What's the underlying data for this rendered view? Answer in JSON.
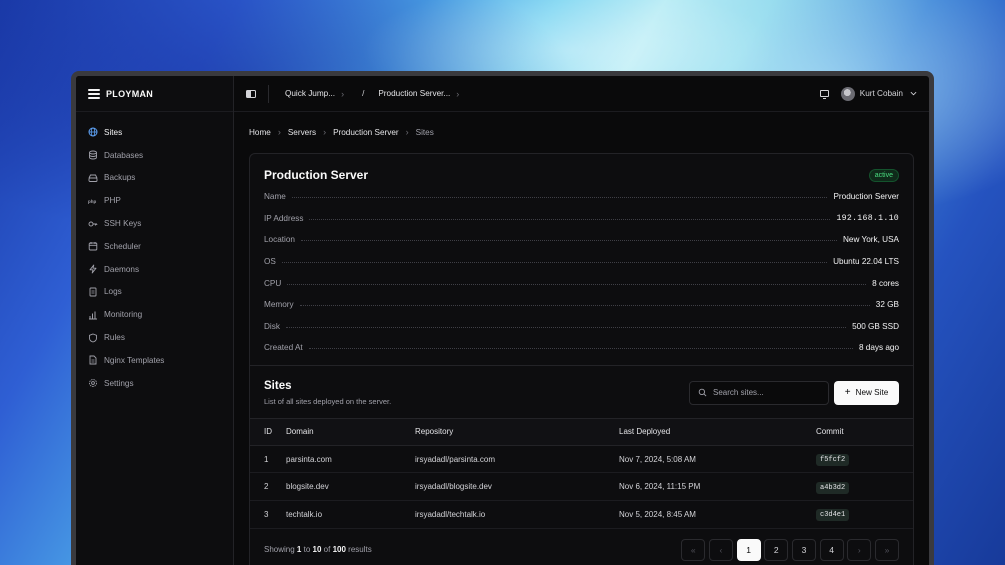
{
  "brand": {
    "name": "PLOYMAN"
  },
  "sidebar": {
    "items": [
      {
        "label": "Sites",
        "icon": "globe-icon",
        "active": true
      },
      {
        "label": "Databases",
        "icon": "database-icon"
      },
      {
        "label": "Backups",
        "icon": "hard-drive-icon"
      },
      {
        "label": "PHP",
        "icon": "php-icon"
      },
      {
        "label": "SSH Keys",
        "icon": "key-icon"
      },
      {
        "label": "Scheduler",
        "icon": "calendar-icon"
      },
      {
        "label": "Daemons",
        "icon": "bolt-icon"
      },
      {
        "label": "Logs",
        "icon": "file-icon"
      },
      {
        "label": "Monitoring",
        "icon": "bar-chart-icon"
      },
      {
        "label": "Rules",
        "icon": "shield-icon"
      },
      {
        "label": "Nginx Templates",
        "icon": "file-text-icon"
      },
      {
        "label": "Settings",
        "icon": "gear-icon"
      }
    ]
  },
  "topbar": {
    "quick_jump": "Quick Jump...",
    "separator": "/",
    "server_select": "Production Server...",
    "user_name": "Kurt Cobain"
  },
  "breadcrumb": {
    "home": "Home",
    "servers": "Servers",
    "server": "Production Server",
    "current": "Sites"
  },
  "server": {
    "title": "Production Server",
    "status": "active",
    "status_color": "#4ade80",
    "details": [
      {
        "label": "Name",
        "value": "Production Server"
      },
      {
        "label": "IP Address",
        "value": "192.168.1.10"
      },
      {
        "label": "Location",
        "value": "New York, USA"
      },
      {
        "label": "OS",
        "value": "Ubuntu 22.04 LTS"
      },
      {
        "label": "CPU",
        "value": "8 cores"
      },
      {
        "label": "Memory",
        "value": "32 GB"
      },
      {
        "label": "Disk",
        "value": "500 GB SSD"
      },
      {
        "label": "Created At",
        "value": "8 days ago"
      }
    ]
  },
  "sites": {
    "title": "Sites",
    "subtitle": "List of all sites deployed on the server.",
    "search_placeholder": "Search sites...",
    "new_button": "New Site",
    "columns": [
      "ID",
      "Domain",
      "Repository",
      "Last Deployed",
      "Commit"
    ],
    "rows": [
      {
        "id": "1",
        "domain": "parsinta.com",
        "repository": "irsyadadl/parsinta.com",
        "last_deployed": "Nov 7, 2024, 5:08 AM",
        "commit": "f5fcf2"
      },
      {
        "id": "2",
        "domain": "blogsite.dev",
        "repository": "irsyadadl/blogsite.dev",
        "last_deployed": "Nov 6, 2024, 11:15 PM",
        "commit": "a4b3d2"
      },
      {
        "id": "3",
        "domain": "techtalk.io",
        "repository": "irsyadadl/techtalk.io",
        "last_deployed": "Nov 5, 2024, 8:45 AM",
        "commit": "c3d4e1"
      }
    ]
  },
  "pagination": {
    "showing": "Showing",
    "from": "1",
    "to_word": "to",
    "to": "10",
    "of_word": "of",
    "total": "100",
    "results": "results",
    "first": "«",
    "prev": "‹",
    "pages": [
      "1",
      "2",
      "3",
      "4"
    ],
    "current_page": "1",
    "next": "›",
    "last": "»"
  }
}
